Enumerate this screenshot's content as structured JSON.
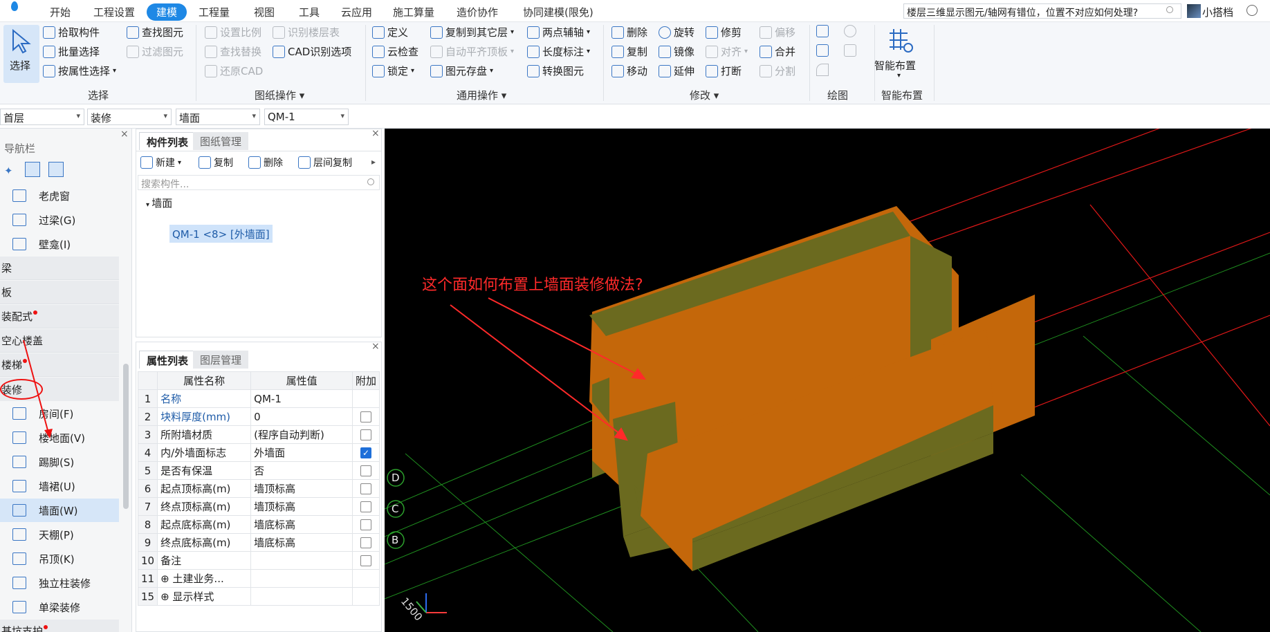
{
  "menubar": {
    "items": [
      "开始",
      "工程设置",
      "建模",
      "工程量",
      "视图",
      "工具",
      "云应用",
      "施工算量",
      "造价协作",
      "协同建模(限免)"
    ],
    "active": "建模",
    "question": "楼层三维显示图元/轴网有错位，位置不对应如何处理?",
    "user": "小搭档"
  },
  "ribbon": {
    "select": {
      "big": "选择",
      "items": [
        "拾取构件",
        "批量选择",
        "按属性选择",
        "查找图元",
        "过滤图元"
      ],
      "group": "选择"
    },
    "drawing": {
      "items": [
        "设置比例",
        "识别楼层表",
        "查找替换",
        "CAD识别选项",
        "还原CAD"
      ],
      "group": "图纸操作"
    },
    "common": {
      "items": [
        "定义",
        "复制到其它层",
        "两点辅轴",
        "云检查",
        "自动平齐顶板",
        "长度标注",
        "锁定",
        "图元存盘",
        "转换图元"
      ],
      "group": "通用操作"
    },
    "modify": {
      "items": [
        "删除",
        "旋转",
        "修剪",
        "偏移",
        "复制",
        "镜像",
        "对齐",
        "合并",
        "移动",
        "延伸",
        "打断",
        "分割"
      ],
      "group": "修改"
    },
    "draw": {
      "group": "绘图"
    },
    "smart": {
      "big": "智能布置",
      "group": "智能布置"
    }
  },
  "filters": {
    "floor": "首层",
    "category": "装修",
    "type": "墙面",
    "component": "QM-1"
  },
  "nav": {
    "title": "导航栏",
    "top_items": [
      "老虎窗",
      "过梁(G)",
      "壁龛(I)"
    ],
    "categories": [
      {
        "label": "梁",
        "dot": false
      },
      {
        "label": "板",
        "dot": false
      },
      {
        "label": "装配式",
        "dot": true
      },
      {
        "label": "空心楼盖",
        "dot": false
      },
      {
        "label": "楼梯",
        "dot": true
      },
      {
        "label": "装修",
        "dot": false
      }
    ],
    "deco_items": [
      "房间(F)",
      "楼地面(V)",
      "踢脚(S)",
      "墙裙(U)",
      "墙面(W)",
      "天棚(P)",
      "吊顶(K)",
      "独立柱装修",
      "单梁装修"
    ],
    "selected": "墙面(W)",
    "bottom_cat": "基坑支护"
  },
  "components": {
    "tabs": [
      "构件列表",
      "图纸管理"
    ],
    "toolbar": [
      "新建",
      "复制",
      "删除",
      "层间复制"
    ],
    "search_placeholder": "搜索构件...",
    "tree_root": "墙面",
    "tree_item": "QM-1 <8> [外墙面]"
  },
  "properties": {
    "tabs": [
      "属性列表",
      "图层管理"
    ],
    "headers": [
      "属性名称",
      "属性值",
      "附加"
    ],
    "rows": [
      {
        "num": "1",
        "name": "名称",
        "value": "QM-1",
        "blue": true,
        "check": null
      },
      {
        "num": "2",
        "name": "块料厚度(mm)",
        "value": "0",
        "blue": true,
        "check": false
      },
      {
        "num": "3",
        "name": "所附墙材质",
        "value": "(程序自动判断)",
        "blue": false,
        "check": false
      },
      {
        "num": "4",
        "name": "内/外墙面标志",
        "value": "外墙面",
        "blue": false,
        "check": true
      },
      {
        "num": "5",
        "name": "是否有保温",
        "value": "否",
        "blue": false,
        "check": false
      },
      {
        "num": "6",
        "name": "起点顶标高(m)",
        "value": "墙顶标高",
        "blue": false,
        "check": false
      },
      {
        "num": "7",
        "name": "终点顶标高(m)",
        "value": "墙顶标高",
        "blue": false,
        "check": false
      },
      {
        "num": "8",
        "name": "起点底标高(m)",
        "value": "墙底标高",
        "blue": false,
        "check": false
      },
      {
        "num": "9",
        "name": "终点底标高(m)",
        "value": "墙底标高",
        "blue": false,
        "check": false
      },
      {
        "num": "10",
        "name": "备注",
        "value": "",
        "blue": false,
        "check": false
      },
      {
        "num": "11",
        "name": "⊕ 土建业务...",
        "value": "",
        "blue": false,
        "check": null
      },
      {
        "num": "15",
        "name": "⊕ 显示样式",
        "value": "",
        "blue": false,
        "check": null
      }
    ]
  },
  "viewport": {
    "annotation": "这个面如何布置上墙面装修做法?",
    "axis_labels": [
      "D",
      "C",
      "B"
    ],
    "view_angle": "1500",
    "colors": {
      "wall": "#c4670a",
      "wall_side": "#6b6a1f",
      "grid": "#1f8f1f",
      "axis_red": "#e01818",
      "annotation": "#ff2a2a"
    }
  }
}
